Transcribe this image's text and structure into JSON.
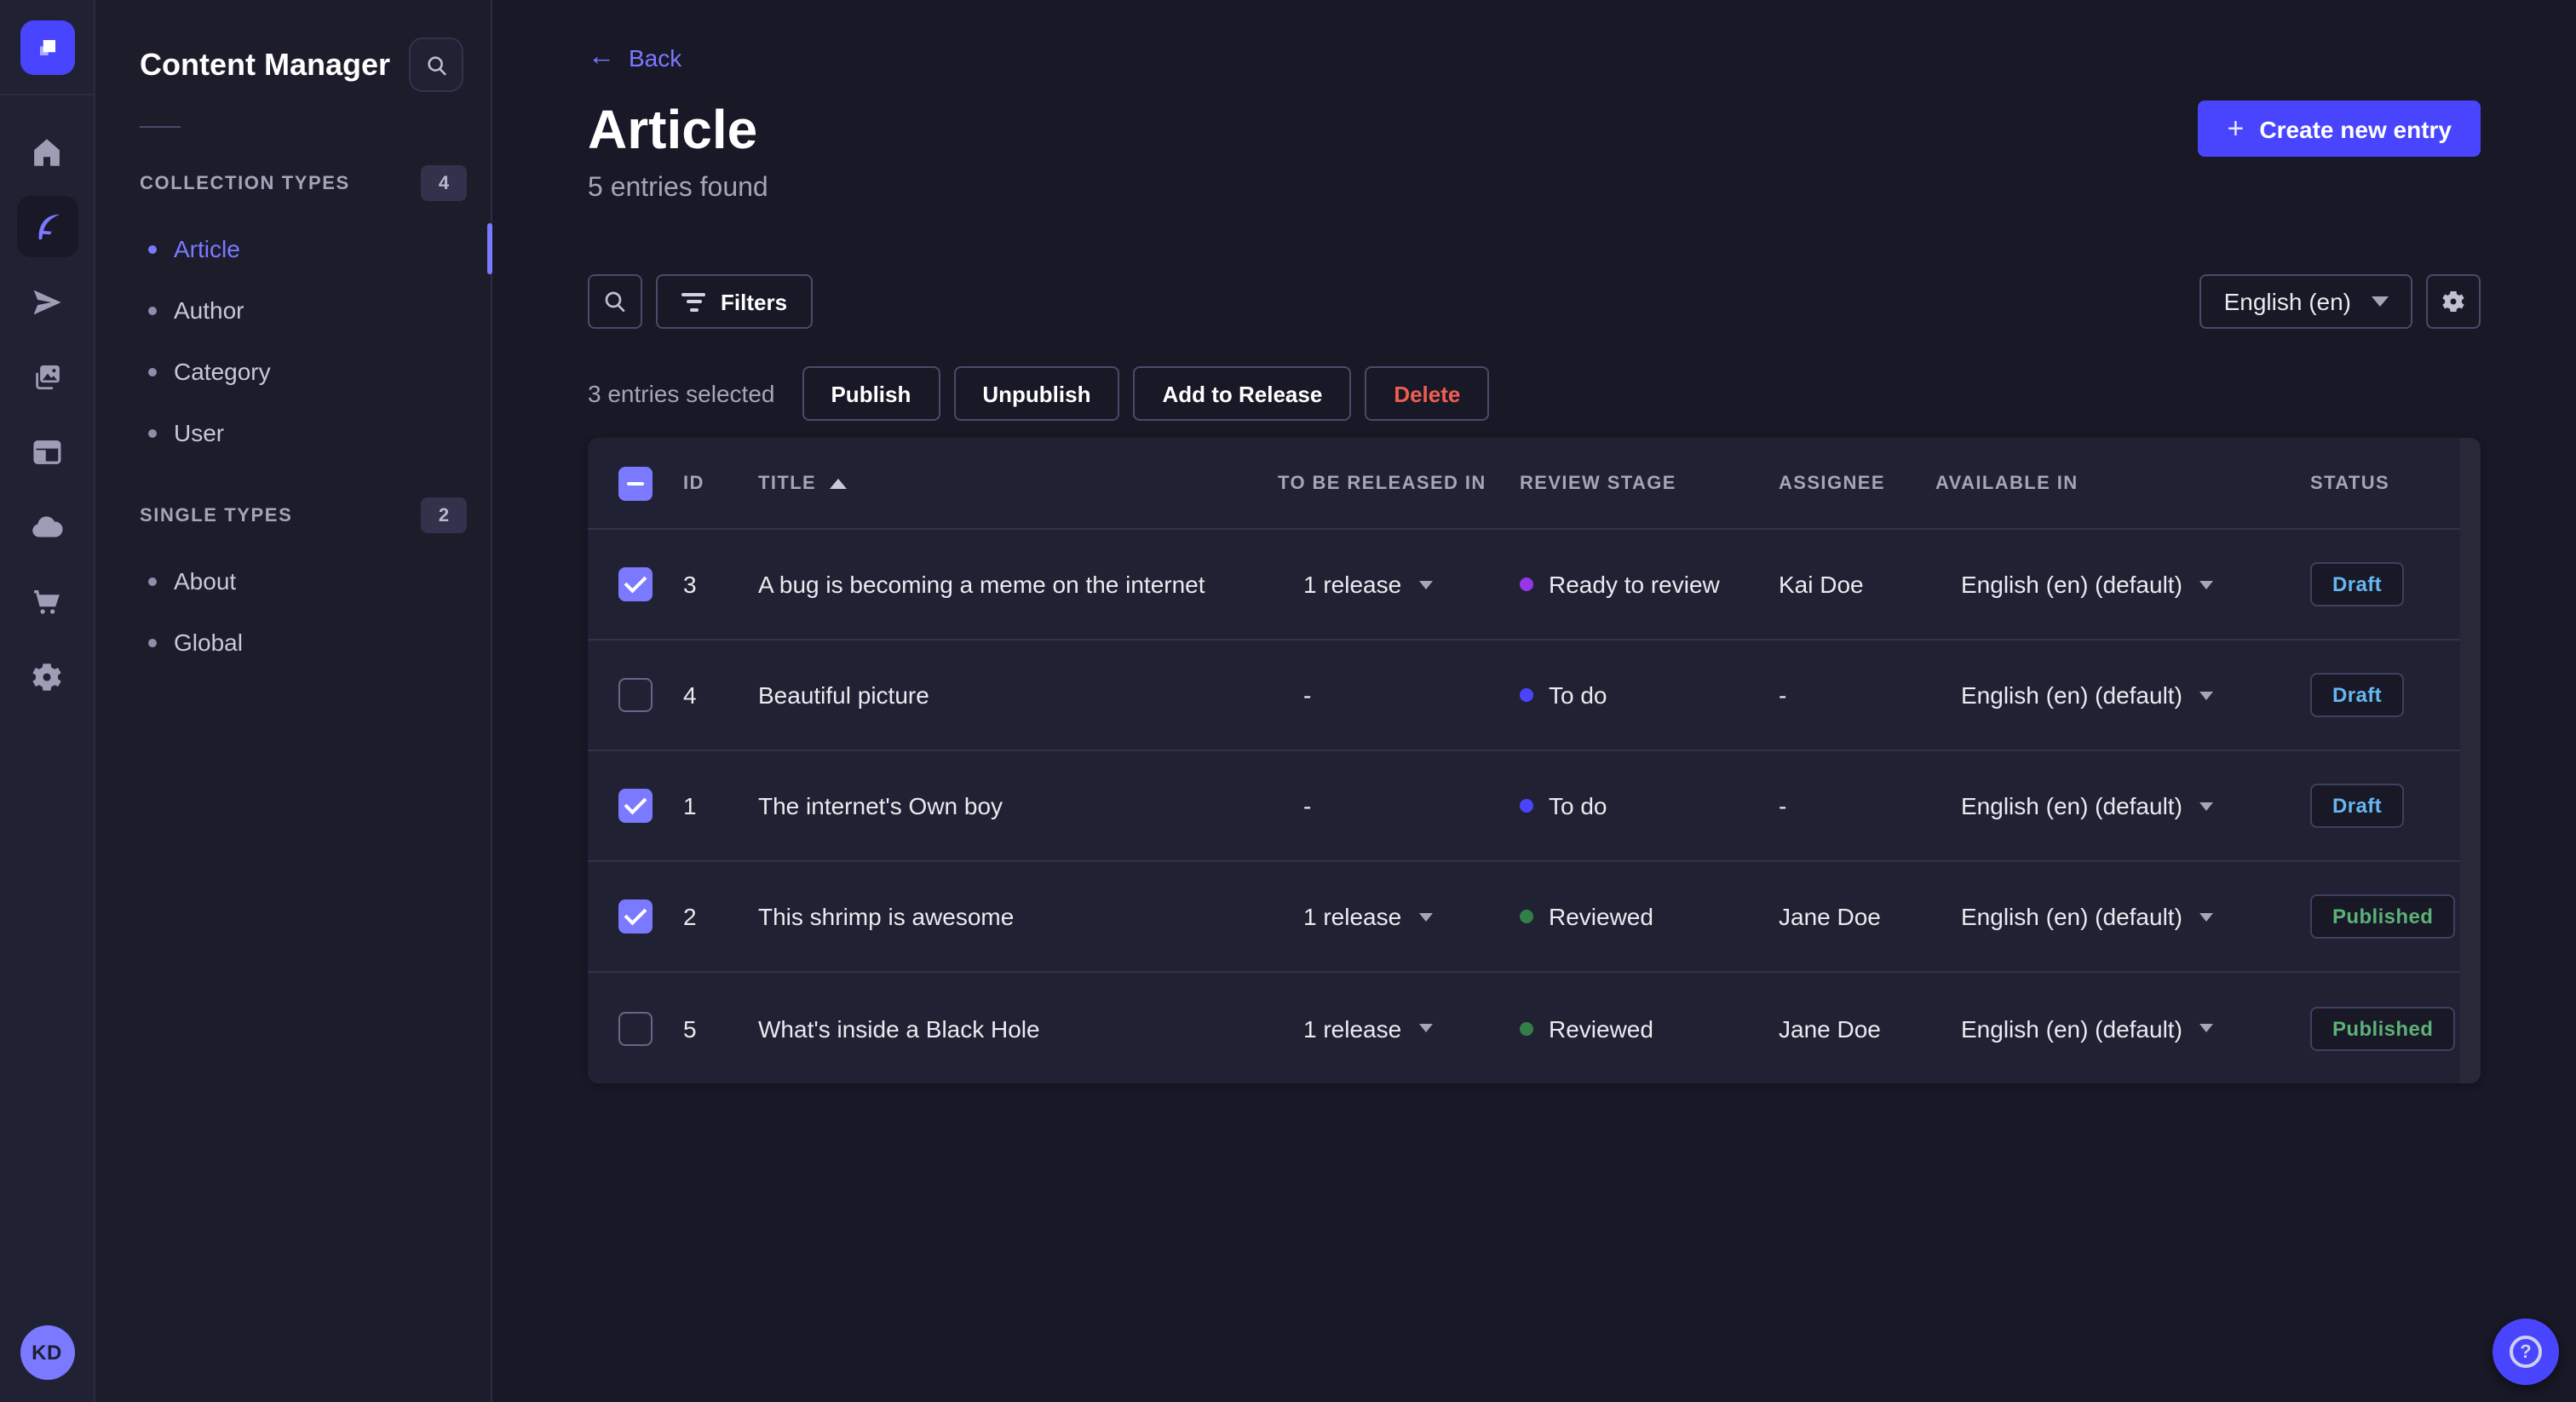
{
  "theme": {
    "accent": "#4945ff",
    "accent_light": "#7b79ff",
    "draft_color": "#66b7f1",
    "published_color": "#5cb176",
    "danger_color": "#ee5e52"
  },
  "rail": {
    "icons": [
      "strapi-logo",
      "home",
      "content-manager",
      "releases",
      "media-library",
      "content-type-builder",
      "cloud",
      "marketplace",
      "settings"
    ],
    "avatar_initials": "KD"
  },
  "subnav": {
    "title": "Content Manager",
    "sections": [
      {
        "label": "COLLECTION TYPES",
        "count": "4",
        "items": [
          {
            "label": "Article",
            "active": true
          },
          {
            "label": "Author",
            "active": false
          },
          {
            "label": "Category",
            "active": false
          },
          {
            "label": "User",
            "active": false
          }
        ]
      },
      {
        "label": "SINGLE TYPES",
        "count": "2",
        "items": [
          {
            "label": "About",
            "active": false
          },
          {
            "label": "Global",
            "active": false
          }
        ]
      }
    ]
  },
  "header": {
    "back_label": "Back",
    "title": "Article",
    "subtitle": "5 entries found",
    "create_button": "Create new entry"
  },
  "toolbar": {
    "filters_label": "Filters",
    "locale_value": "English (en)"
  },
  "selection": {
    "text": "3 entries selected",
    "publish_label": "Publish",
    "unpublish_label": "Unpublish",
    "add_to_release_label": "Add to Release",
    "delete_label": "Delete"
  },
  "table": {
    "columns": [
      "ID",
      "TITLE",
      "TO BE RELEASED IN",
      "REVIEW STAGE",
      "ASSIGNEE",
      "AVAILABLE IN",
      "STATUS"
    ],
    "sorted_column": "TITLE",
    "sort_direction": "asc",
    "rows": [
      {
        "checked": true,
        "id": "3",
        "title": "A bug is becoming a meme on the internet",
        "released": "1 release",
        "stage": "Ready to review",
        "stage_color": "#9736e8",
        "assignee": "Kai Doe",
        "available": "English (en) (default)",
        "status": "Draft"
      },
      {
        "checked": false,
        "id": "4",
        "title": "Beautiful picture",
        "released": "-",
        "stage": "To do",
        "stage_color": "#4945ff",
        "assignee": "-",
        "available": "English (en) (default)",
        "status": "Draft"
      },
      {
        "checked": true,
        "id": "1",
        "title": "The internet's Own boy",
        "released": "-",
        "stage": "To do",
        "stage_color": "#4945ff",
        "assignee": "-",
        "available": "English (en) (default)",
        "status": "Draft"
      },
      {
        "checked": true,
        "id": "2",
        "title": "This shrimp is awesome",
        "released": "1 release",
        "stage": "Reviewed",
        "stage_color": "#328048",
        "assignee": "Jane Doe",
        "available": "English (en) (default)",
        "status": "Published"
      },
      {
        "checked": false,
        "id": "5",
        "title": "What's inside a Black Hole",
        "released": "1 release",
        "stage": "Reviewed",
        "stage_color": "#328048",
        "assignee": "Jane Doe",
        "available": "English (en) (default)",
        "status": "Published"
      }
    ]
  },
  "help": {
    "glyph": "?"
  }
}
